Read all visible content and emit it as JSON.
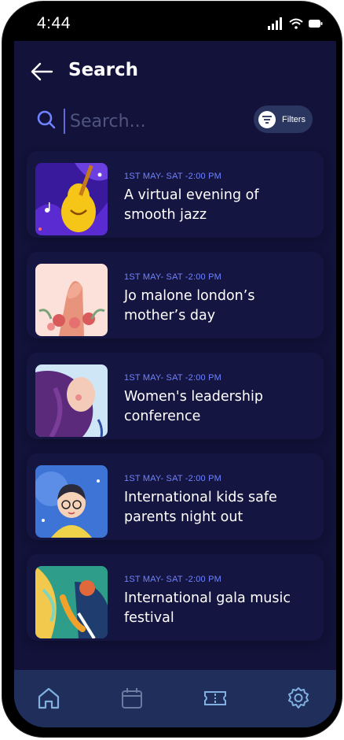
{
  "status_bar": {
    "time": "4:44"
  },
  "header": {
    "title": "Search"
  },
  "search": {
    "placeholder": "Search...",
    "filters_label": "Filters"
  },
  "events": [
    {
      "date": "1ST  MAY- SAT -2:00 PM",
      "title": "A virtual evening of smooth jazz",
      "image": "jazz-guitar-illustration"
    },
    {
      "date": "1ST  MAY- SAT -2:00 PM",
      "title": "Jo malone london’s mother’s day",
      "image": "flowers-hand-illustration"
    },
    {
      "date": "1ST  MAY- SAT -2:00 PM",
      "title": "Women's leadership conference",
      "image": "woman-portrait-illustration"
    },
    {
      "date": "1ST  MAY- SAT -2:00 PM",
      "title": "International kids safe parents night out",
      "image": "kid-with-glasses-illustration"
    },
    {
      "date": "1ST  MAY- SAT -2:00 PM",
      "title": "International gala music festival",
      "image": "saxophone-player-illustration"
    }
  ],
  "bottom_nav": [
    {
      "icon": "home-icon",
      "active": true
    },
    {
      "icon": "calendar-icon",
      "active": false
    },
    {
      "icon": "ticket-icon",
      "active": false
    },
    {
      "icon": "settings-icon",
      "active": false
    }
  ],
  "colors": {
    "background": "#12123a",
    "card": "#151541",
    "accent": "#6f82ff",
    "nav": "#1f2e5a",
    "nav_icon": "#7fb0e0"
  }
}
